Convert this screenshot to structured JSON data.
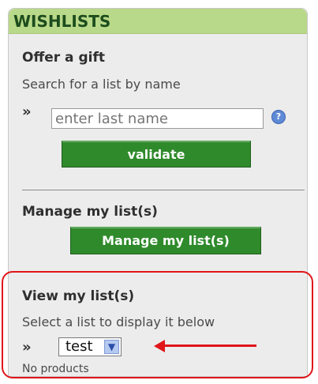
{
  "header": {
    "title": "WISHLISTS"
  },
  "offer": {
    "title": "Offer a gift",
    "subtitle": "Search for a list by name",
    "bullet": "»",
    "placeholder": "enter last name",
    "help": "?",
    "button": "validate"
  },
  "manage": {
    "title": "Manage my list(s)",
    "button": "Manage my list(s)"
  },
  "view": {
    "title": "View my list(s)",
    "subtitle": "Select a list to display it below",
    "bullet": "»",
    "selected": "test",
    "arrow": "▼",
    "no_products": "No products"
  },
  "colors": {
    "header_bg": "#b9d98a",
    "button_green": "#2f8a2b",
    "annotation_red": "#e0161a"
  }
}
